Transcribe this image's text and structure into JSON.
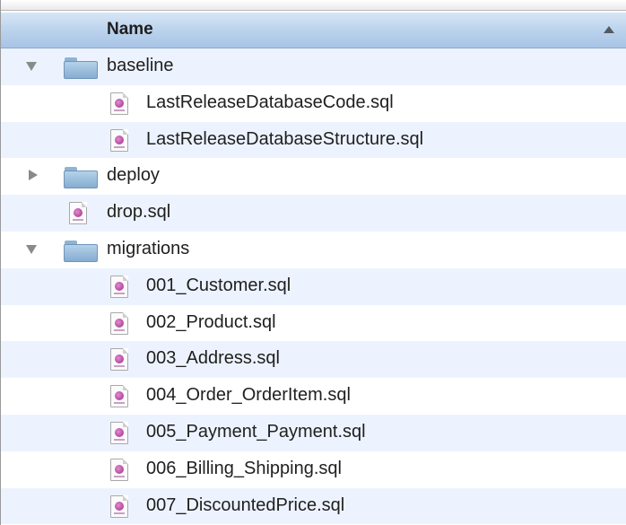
{
  "header": {
    "column_name": "Name",
    "sort_indicator": "ascending"
  },
  "rows": [
    {
      "name": "baseline",
      "kind": "folder",
      "state": "expanded",
      "level": 0
    },
    {
      "name": "LastReleaseDatabaseCode.sql",
      "kind": "sql-file",
      "level": 1
    },
    {
      "name": "LastReleaseDatabaseStructure.sql",
      "kind": "sql-file",
      "level": 1
    },
    {
      "name": "deploy",
      "kind": "folder",
      "state": "collapsed",
      "level": 0
    },
    {
      "name": "drop.sql",
      "kind": "sql-file",
      "level": 0
    },
    {
      "name": "migrations",
      "kind": "folder",
      "state": "expanded",
      "level": 0
    },
    {
      "name": "001_Customer.sql",
      "kind": "sql-file",
      "level": 1
    },
    {
      "name": "002_Product.sql",
      "kind": "sql-file",
      "level": 1
    },
    {
      "name": "003_Address.sql",
      "kind": "sql-file",
      "level": 1
    },
    {
      "name": "004_Order_OrderItem.sql",
      "kind": "sql-file",
      "level": 1
    },
    {
      "name": "005_Payment_Payment.sql",
      "kind": "sql-file",
      "level": 1
    },
    {
      "name": "006_Billing_Shipping.sql",
      "kind": "sql-file",
      "level": 1
    },
    {
      "name": "007_DiscountedPrice.sql",
      "kind": "sql-file",
      "level": 1
    }
  ],
  "colors": {
    "header_gradient_top": "#d7e6f7",
    "header_gradient_bottom": "#a8c4e6",
    "alternate_row": "#edf3fe",
    "folder": "#9dc0e0",
    "sql_file_badge": "#b33f9e"
  },
  "icons": {
    "folder": "folder-icon",
    "sql_file": "sql-file-icon",
    "expanded": "disclosure-down-icon",
    "collapsed": "disclosure-right-icon",
    "sort": "sort-ascending-icon"
  }
}
